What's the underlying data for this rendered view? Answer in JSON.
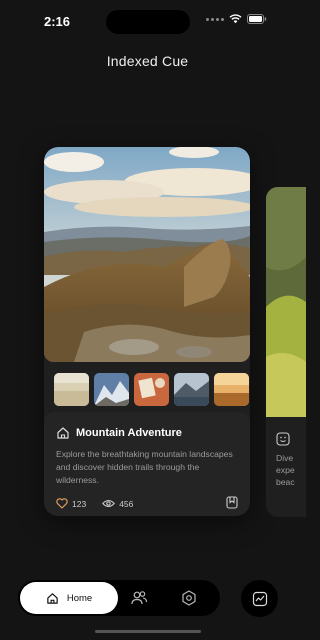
{
  "status_bar": {
    "time": "2:16"
  },
  "page": {
    "title": "Indexed Cue"
  },
  "card": {
    "title": "Mountain Adventure",
    "description": "Explore the breathtaking mountain landscapes and discover hidden trails through the wilderness.",
    "likes": "123",
    "views": "456",
    "thumbnails": [
      "beach-thumbnail",
      "snowy-mountain-thumbnail",
      "desk-thumbnail",
      "lake-mountain-thumbnail",
      "sunset-field-thumbnail"
    ]
  },
  "next_card": {
    "text_lines": [
      "Dive",
      "expe",
      "beac"
    ]
  },
  "nav": {
    "home_label": "Home"
  },
  "colors": {
    "background": "#141414",
    "card": "#1f1f1f",
    "nav": "#000000",
    "active_pill": "#ffffff"
  }
}
